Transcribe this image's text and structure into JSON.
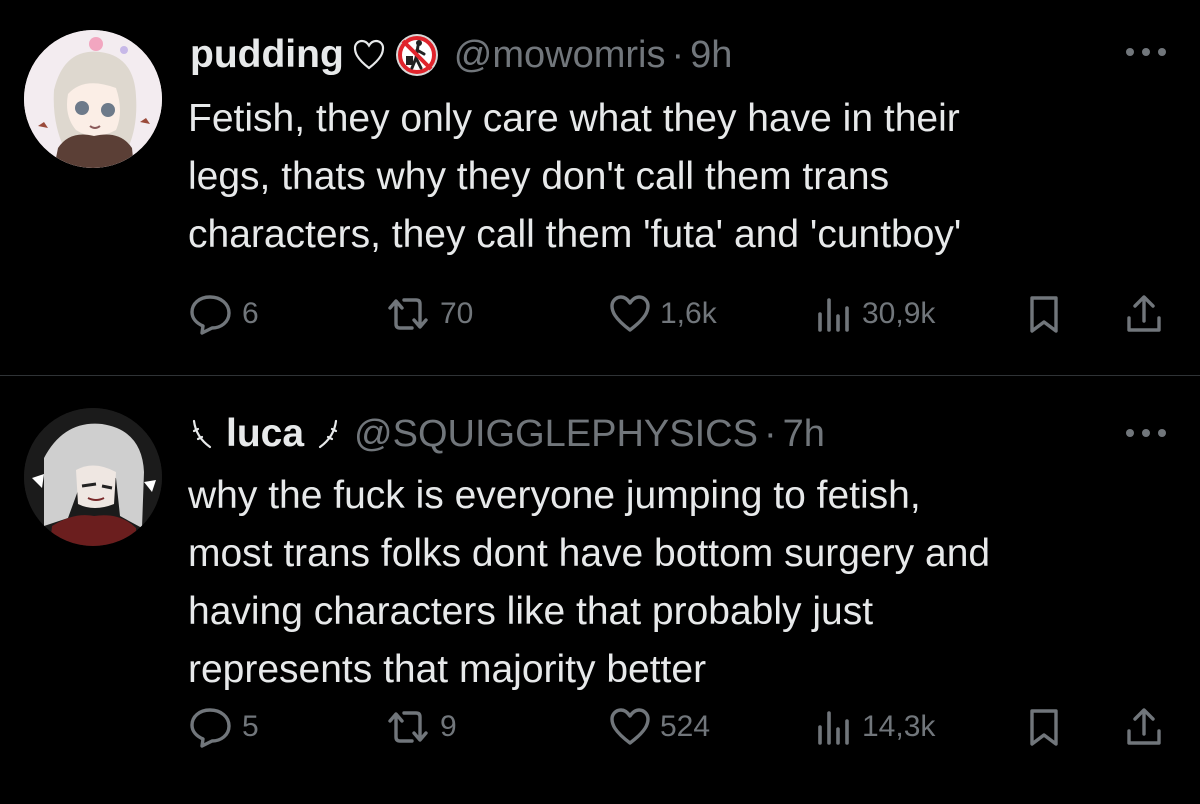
{
  "tweets": [
    {
      "name": "pudding",
      "handle": "@mowomris",
      "time": "9h",
      "text_lines": [
        "Fetish, they only care what they have in their",
        "legs, thats why they don't call them trans",
        "characters, they call them 'futa' and 'cuntboy'"
      ],
      "replies": "6",
      "reposts": "70",
      "likes": "1,6k",
      "views": "30,9k"
    },
    {
      "name": "luca",
      "handle": "@SQUIGGLEPHYSICS",
      "time": "7h",
      "text_lines": [
        "why the fuck is everyone jumping to fetish,",
        "most trans folks dont have bottom surgery and",
        "having characters like that probably just",
        "represents that majority better"
      ],
      "replies": "5",
      "reposts": "9",
      "likes": "524",
      "views": "14,3k"
    }
  ],
  "icons": {
    "reply": "reply-icon",
    "repost": "repost-icon",
    "like": "heart-icon",
    "views": "views-icon",
    "bookmark": "bookmark-icon",
    "share": "share-icon",
    "more": "more-icon"
  },
  "colors": {
    "background": "#000000",
    "text": "#e7e9ea",
    "secondary": "#71767b",
    "divider": "#2f3336"
  }
}
